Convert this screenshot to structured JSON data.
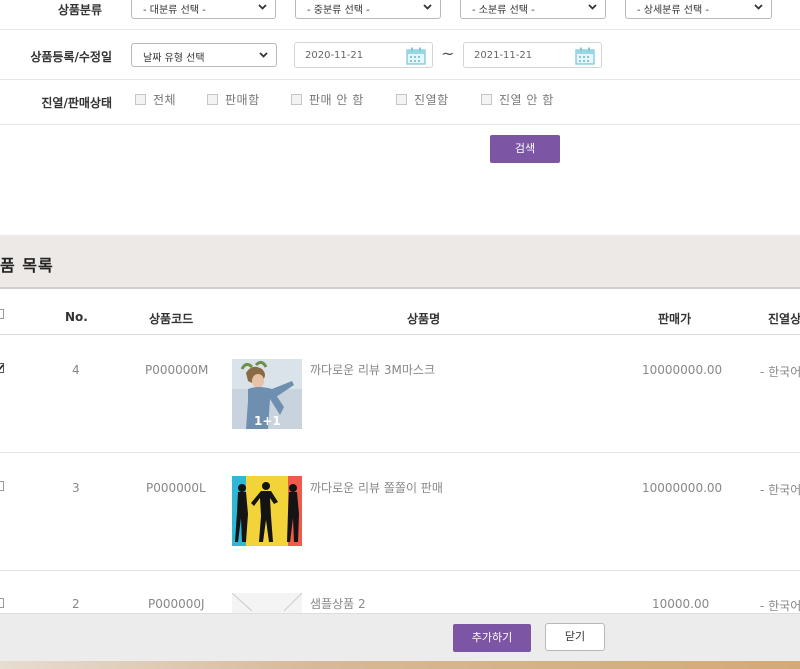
{
  "filters": {
    "category_label": "상품분류",
    "category_selects": [
      "- 대분류 선택 -",
      "- 중분류 선택 -",
      "- 소분류 선택 -",
      "- 상세분류 선택 -"
    ],
    "date_label": "상품등록/수정일",
    "date_type": "날짜 유형 선택",
    "date_from": "2020-11-21",
    "date_to": "2021-11-21",
    "date_sep": "~",
    "status_label": "진열/판매상태",
    "status_options": [
      "전체",
      "판매함",
      "판매 안 함",
      "진열함",
      "진열 안 함"
    ],
    "search_button": "검색"
  },
  "list": {
    "title": "품 목록",
    "columns": [
      "No.",
      "상품코드",
      "상품명",
      "판매가",
      "진열상"
    ],
    "rows": [
      {
        "no": "4",
        "code": "P000000M",
        "name": "까다로운 리뷰 3M마스크",
        "price": "10000000.00",
        "display": "- 한국어",
        "checked": true,
        "thumb": "mask-product-thumbnail"
      },
      {
        "no": "3",
        "code": "P000000L",
        "name": "까다로운 리뷰 쫄쫄이 판매",
        "price": "10000000.00",
        "display": "- 한국어",
        "checked": false,
        "thumb": "tights-product-thumbnail"
      },
      {
        "no": "2",
        "code": "P000000J",
        "name": "샘플상품 2",
        "price": "10000.00",
        "display": "- 한국어",
        "checked": false,
        "thumb": "empty-thumbnail"
      }
    ],
    "thumb_badge": "1+1"
  },
  "footer": {
    "add_button": "추가하기",
    "close_button": "닫기"
  },
  "colors": {
    "accent": "#7d55a5",
    "header_band": "#ece9e6",
    "calendar_icon": "#7ec8d8"
  }
}
